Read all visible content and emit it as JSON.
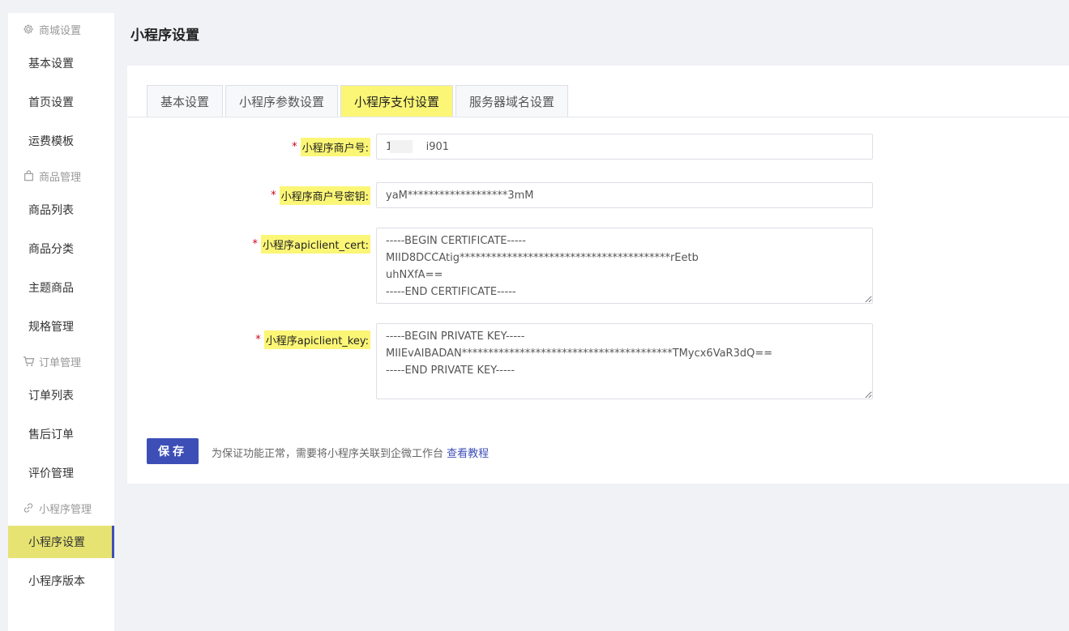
{
  "sidebar": {
    "groups": [
      {
        "title": "商城设置",
        "icon": "gear-icon"
      },
      {
        "title": "商品管理",
        "icon": "bag-icon"
      },
      {
        "title": "订单管理",
        "icon": "cart-icon"
      },
      {
        "title": "小程序管理",
        "icon": "link-icon"
      }
    ],
    "items": [
      {
        "label": "基本设置"
      },
      {
        "label": "首页设置"
      },
      {
        "label": "运费模板"
      },
      {
        "label": "商品列表"
      },
      {
        "label": "商品分类"
      },
      {
        "label": "主题商品"
      },
      {
        "label": "规格管理"
      },
      {
        "label": "订单列表"
      },
      {
        "label": "售后订单"
      },
      {
        "label": "评价管理"
      },
      {
        "label": "小程序设置",
        "active": true
      },
      {
        "label": "小程序版本"
      }
    ]
  },
  "header": {
    "title": "小程序设置"
  },
  "tabs": [
    {
      "label": "基本设置"
    },
    {
      "label": "小程序参数设置"
    },
    {
      "label": "小程序支付设置",
      "active": true
    },
    {
      "label": "服务器域名设置"
    }
  ],
  "form": {
    "required_mark": "*",
    "mch_id": {
      "label": "小程序商户号:",
      "value": "1          i901"
    },
    "mch_key": {
      "label": "小程序商户号密钥:",
      "value": "yaM*******************3mM"
    },
    "cert": {
      "label": "小程序apiclient_cert:",
      "value": "-----BEGIN CERTIFICATE-----\nMIID8DCCAtig****************************************rEetb\nuhNXfA==\n-----END CERTIFICATE-----"
    },
    "key": {
      "label": "小程序apiclient_key:",
      "value": "-----BEGIN PRIVATE KEY-----\nMIIEvAIBADAN****************************************TMycx6VaR3dQ==\n-----END PRIVATE KEY-----"
    }
  },
  "footer": {
    "save_label": "保存",
    "tip": "为保证功能正常，需要将小程序关联到企微工作台",
    "tip_link": "查看教程"
  },
  "colors": {
    "accent": "#3d4fb7",
    "highlight": "#fbf676",
    "active_menu": "#e6e372",
    "required": "#d0021b"
  }
}
